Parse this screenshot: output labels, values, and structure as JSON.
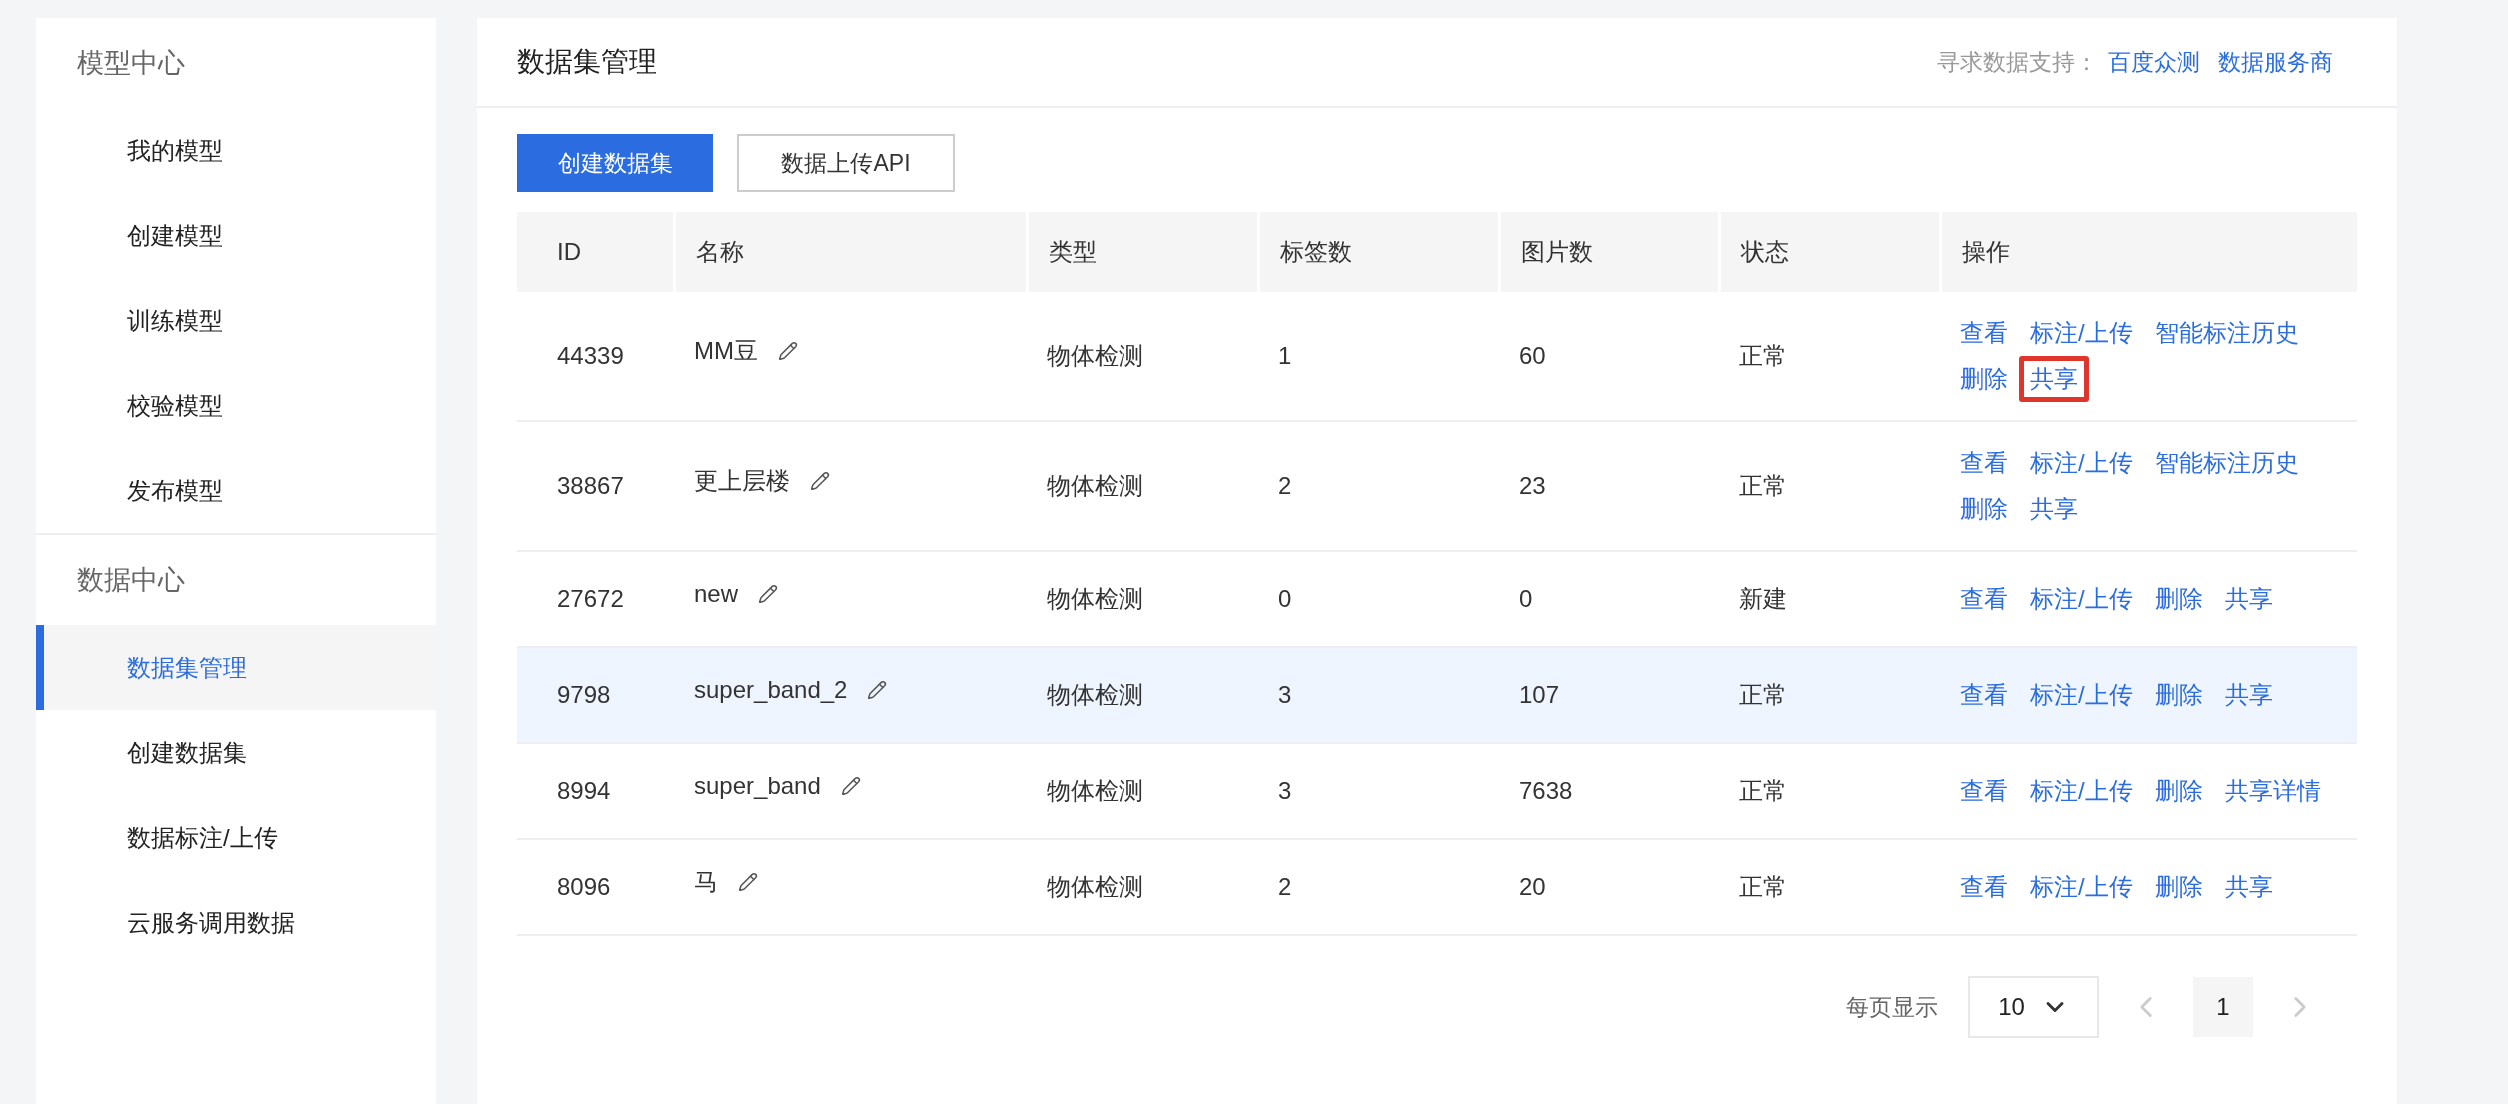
{
  "sidebar": {
    "sections": [
      {
        "title": "模型中心",
        "items": [
          {
            "label": "我的模型",
            "selected": false
          },
          {
            "label": "创建模型",
            "selected": false
          },
          {
            "label": "训练模型",
            "selected": false
          },
          {
            "label": "校验模型",
            "selected": false
          },
          {
            "label": "发布模型",
            "selected": false
          }
        ]
      },
      {
        "title": "数据中心",
        "items": [
          {
            "label": "数据集管理",
            "selected": true
          },
          {
            "label": "创建数据集",
            "selected": false
          },
          {
            "label": "数据标注/上传",
            "selected": false
          },
          {
            "label": "云服务调用数据",
            "selected": false
          }
        ]
      }
    ]
  },
  "page": {
    "title": "数据集管理",
    "support_label": "寻求数据支持：",
    "support_links": [
      "百度众测",
      "数据服务商"
    ]
  },
  "toolbar": {
    "buttons": [
      {
        "label": "创建数据集",
        "kind": "primary"
      },
      {
        "label": "数据上传API",
        "kind": "default"
      }
    ]
  },
  "table": {
    "columns": [
      "ID",
      "名称",
      "类型",
      "标签数",
      "图片数",
      "状态",
      "操作"
    ],
    "rows": [
      {
        "id": "44339",
        "name": "MM豆",
        "type": "物体检测",
        "labels": "1",
        "images": "60",
        "status": "正常",
        "hovered": false,
        "actions": [
          {
            "label": "查看",
            "highlighted": false
          },
          {
            "label": "标注/上传",
            "highlighted": false
          },
          {
            "label": "智能标注历史",
            "highlighted": false
          },
          {
            "label": "删除",
            "highlighted": false
          },
          {
            "label": "共享",
            "highlighted": true
          }
        ]
      },
      {
        "id": "38867",
        "name": "更上层楼",
        "type": "物体检测",
        "labels": "2",
        "images": "23",
        "status": "正常",
        "hovered": false,
        "actions": [
          {
            "label": "查看",
            "highlighted": false
          },
          {
            "label": "标注/上传",
            "highlighted": false
          },
          {
            "label": "智能标注历史",
            "highlighted": false
          },
          {
            "label": "删除",
            "highlighted": false
          },
          {
            "label": "共享",
            "highlighted": false
          }
        ]
      },
      {
        "id": "27672",
        "name": "new",
        "type": "物体检测",
        "labels": "0",
        "images": "0",
        "status": "新建",
        "hovered": false,
        "actions": [
          {
            "label": "查看",
            "highlighted": false
          },
          {
            "label": "标注/上传",
            "highlighted": false
          },
          {
            "label": "删除",
            "highlighted": false
          },
          {
            "label": "共享",
            "highlighted": false
          }
        ]
      },
      {
        "id": "9798",
        "name": "super_band_2",
        "type": "物体检测",
        "labels": "3",
        "images": "107",
        "status": "正常",
        "hovered": true,
        "actions": [
          {
            "label": "查看",
            "highlighted": false
          },
          {
            "label": "标注/上传",
            "highlighted": false
          },
          {
            "label": "删除",
            "highlighted": false
          },
          {
            "label": "共享",
            "highlighted": false
          }
        ]
      },
      {
        "id": "8994",
        "name": "super_band",
        "type": "物体检测",
        "labels": "3",
        "images": "7638",
        "status": "正常",
        "hovered": false,
        "actions": [
          {
            "label": "查看",
            "highlighted": false
          },
          {
            "label": "标注/上传",
            "highlighted": false
          },
          {
            "label": "删除",
            "highlighted": false
          },
          {
            "label": "共享详情",
            "highlighted": false
          }
        ]
      },
      {
        "id": "8096",
        "name": "马",
        "type": "物体检测",
        "labels": "2",
        "images": "20",
        "status": "正常",
        "hovered": false,
        "actions": [
          {
            "label": "查看",
            "highlighted": false
          },
          {
            "label": "标注/上传",
            "highlighted": false
          },
          {
            "label": "删除",
            "highlighted": false
          },
          {
            "label": "共享",
            "highlighted": false
          }
        ]
      }
    ]
  },
  "pagination": {
    "page_size_label": "每页显示",
    "page_size": "10",
    "prev_disabled": true,
    "next_disabled": true,
    "pages": [
      {
        "label": "1",
        "selected": true
      }
    ]
  }
}
